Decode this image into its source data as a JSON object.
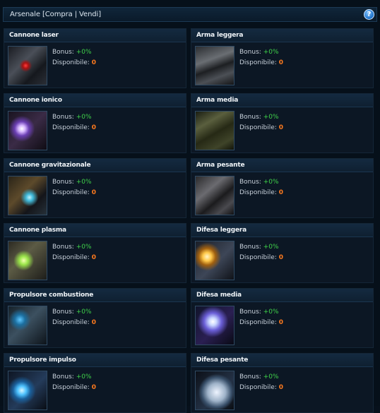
{
  "header": {
    "title": "Arsenale [Compra | Vendi]",
    "help_label": "?"
  },
  "labels": {
    "bonus": "Bonus:",
    "available": "Disponibile:"
  },
  "items": [
    {
      "name": "Cannone laser",
      "bonus": "+0%",
      "available": "0",
      "image": "laser-cannon-image"
    },
    {
      "name": "Arma leggera",
      "bonus": "+0%",
      "available": "0",
      "image": "light-weapon-image"
    },
    {
      "name": "Cannone ionico",
      "bonus": "+0%",
      "available": "0",
      "image": "ion-cannon-image"
    },
    {
      "name": "Arma media",
      "bonus": "+0%",
      "available": "0",
      "image": "medium-weapon-image"
    },
    {
      "name": "Cannone gravitazionale",
      "bonus": "+0%",
      "available": "0",
      "image": "gravity-cannon-image"
    },
    {
      "name": "Arma pesante",
      "bonus": "+0%",
      "available": "0",
      "image": "heavy-weapon-image"
    },
    {
      "name": "Cannone plasma",
      "bonus": "+0%",
      "available": "0",
      "image": "plasma-cannon-image"
    },
    {
      "name": "Difesa leggera",
      "bonus": "+0%",
      "available": "0",
      "image": "light-defense-image"
    },
    {
      "name": "Propulsore combustione",
      "bonus": "+0%",
      "available": "0",
      "image": "combustion-thruster-image"
    },
    {
      "name": "Difesa media",
      "bonus": "+0%",
      "available": "0",
      "image": "medium-defense-image"
    },
    {
      "name": "Propulsore impulso",
      "bonus": "+0%",
      "available": "0",
      "image": "impulse-thruster-image"
    },
    {
      "name": "Difesa pesante",
      "bonus": "+0%",
      "available": "0",
      "image": "heavy-defense-image"
    }
  ]
}
